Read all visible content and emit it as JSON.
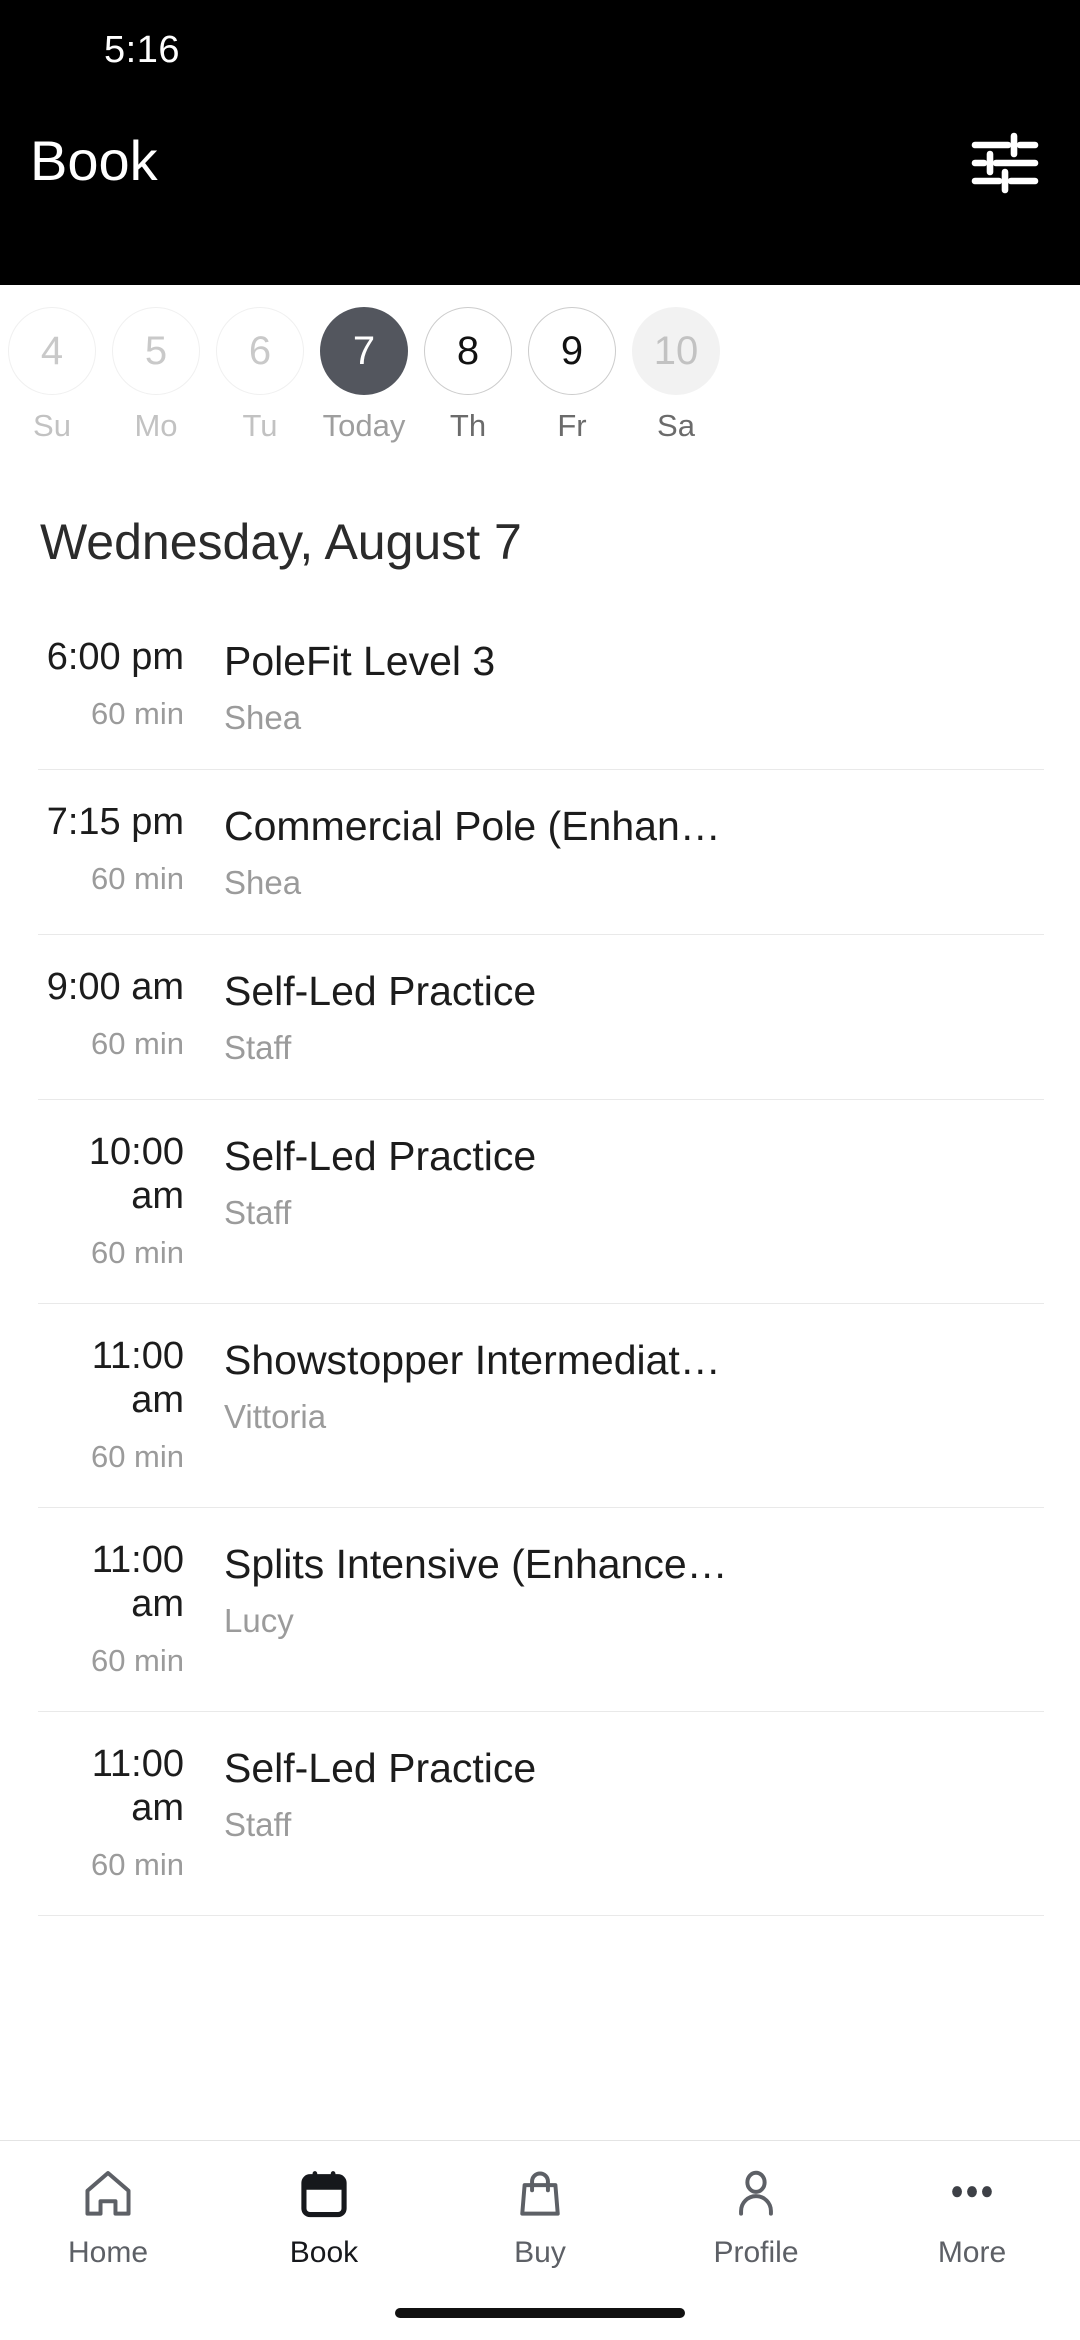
{
  "status_bar": {
    "time": "5:16"
  },
  "header": {
    "title": "Book",
    "filter_icon": "sliders-filter-icon"
  },
  "date_strip": {
    "days": [
      {
        "number": "4",
        "label": "Su",
        "state": "disabled"
      },
      {
        "number": "5",
        "label": "Mo",
        "state": "disabled"
      },
      {
        "number": "6",
        "label": "Tu",
        "state": "disabled"
      },
      {
        "number": "7",
        "label": "Today",
        "state": "selected"
      },
      {
        "number": "8",
        "label": "Th",
        "state": "available"
      },
      {
        "number": "9",
        "label": "Fr",
        "state": "available"
      },
      {
        "number": "10",
        "label": "Sa",
        "state": "upcoming"
      }
    ]
  },
  "schedule": {
    "day_heading": "Wednesday, August 7",
    "classes": [
      {
        "time": "6:00 pm",
        "duration": "60 min",
        "name": "PoleFit Level 3",
        "instructor": "Shea"
      },
      {
        "time": "7:15 pm",
        "duration": "60 min",
        "name": "Commercial Pole (Enhan…",
        "instructor": "Shea"
      },
      {
        "time": "9:00 am",
        "duration": "60 min",
        "name": "Self-Led Practice",
        "instructor": "Staff"
      },
      {
        "time": "10:00 am",
        "duration": "60 min",
        "name": "Self-Led Practice",
        "instructor": "Staff"
      },
      {
        "time": "11:00 am",
        "duration": "60 min",
        "name": "Showstopper Intermediat…",
        "instructor": "Vittoria"
      },
      {
        "time": "11:00 am",
        "duration": "60 min",
        "name": "Splits Intensive (Enhance…",
        "instructor": "Lucy"
      },
      {
        "time": "11:00 am",
        "duration": "60 min",
        "name": "Self-Led Practice",
        "instructor": "Staff"
      }
    ]
  },
  "bottom_nav": {
    "items": [
      {
        "label": "Home",
        "icon": "home-icon",
        "active": false
      },
      {
        "label": "Book",
        "icon": "calendar-icon",
        "active": true
      },
      {
        "label": "Buy",
        "icon": "bag-icon",
        "active": false
      },
      {
        "label": "Profile",
        "icon": "person-icon",
        "active": false
      },
      {
        "label": "More",
        "icon": "ellipsis-icon",
        "active": false
      }
    ]
  },
  "colors": {
    "header_background": "#000000",
    "selected_day": "#53565e",
    "upcoming_day": "#f2f2f2",
    "primary_text": "#1c1c1c",
    "muted_text": "#9b9b9b",
    "divider": "#e9e9e9"
  }
}
